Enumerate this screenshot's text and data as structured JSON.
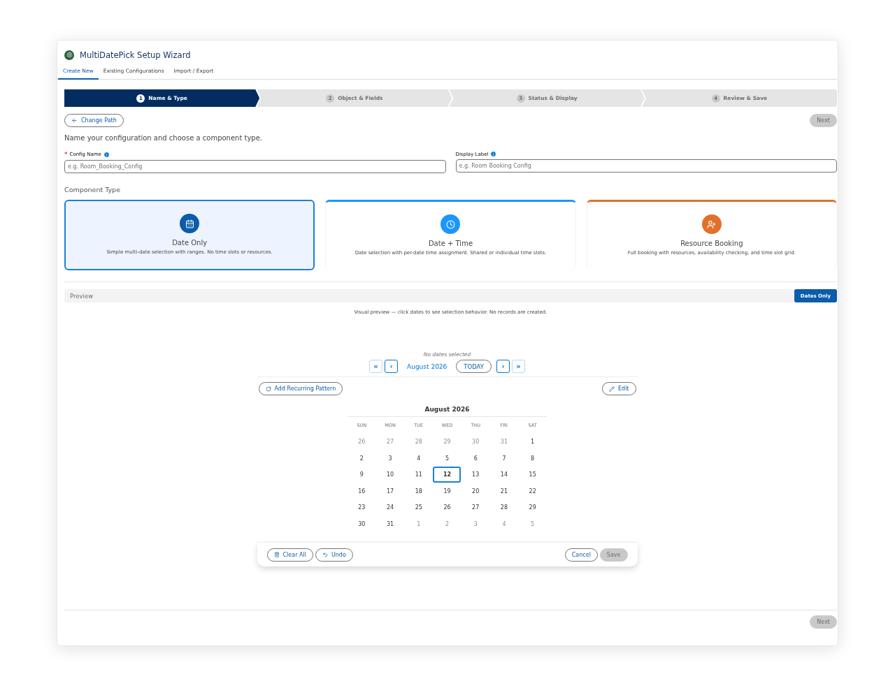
{
  "window": {
    "title": "MultiDatePick Setup Wizard"
  },
  "tabs": [
    {
      "label": "Create New",
      "selected": true
    },
    {
      "label": "Existing Configurations",
      "selected": false
    },
    {
      "label": "Import / Export",
      "selected": false
    }
  ],
  "steps": [
    {
      "number": "1",
      "label": "Name & Type",
      "selected": true
    },
    {
      "number": "2",
      "label": "Object & Fields",
      "selected": false
    },
    {
      "number": "3",
      "label": "Status & Display",
      "selected": false
    },
    {
      "number": "4",
      "label": "Review & Save",
      "selected": false
    }
  ],
  "change_path_button": "Change Path",
  "next_button_top": {
    "label": "Next",
    "disabled": true
  },
  "description": "Name your configuration and choose a component type.",
  "fields": [
    {
      "required_mark": "*",
      "label": "Config Name",
      "placeholder": "e.g. Room_Booking_Config"
    },
    {
      "label": "Display Label",
      "placeholder": "e.g. Room Booking Config"
    }
  ],
  "component_type_label": "Component Type",
  "component_types": [
    {
      "kind": "calendar",
      "title": "Date Only",
      "description": "Simple multi-date selection with ranges. No time slots or resources.",
      "color": "#0b5cab",
      "selected": true
    },
    {
      "kind": "clock",
      "title": "Date + Time",
      "description": "Date selection with per-date time assignment. Shared or individual time slots.",
      "color": "#1b96ff",
      "selected": false
    },
    {
      "kind": "people",
      "title": "Resource Booking",
      "description": "Full booking with resources, availability checking, and time slot grid.",
      "color": "#e3702a",
      "selected": false
    }
  ],
  "preview": {
    "label": "Preview",
    "mode_badge": "Dates Only",
    "hint": "Visual preview — click dates to see selection behavior. No records are created."
  },
  "calendar": {
    "status": "No dates selected",
    "nav": {
      "first": "«",
      "prev": "‹",
      "month": "August 2026",
      "today": "TODAY",
      "next": "›",
      "last": "»"
    },
    "add_recurring_button": "Add Recurring Pattern",
    "edit_button": "Edit",
    "month_title": "August 2026",
    "weekdays": [
      "SUN",
      "MON",
      "TUE",
      "WED",
      "THU",
      "FRI",
      "SAT"
    ],
    "weeks": [
      [
        {
          "day": "26",
          "outside": true,
          "today": false
        },
        {
          "day": "27",
          "outside": true,
          "today": false
        },
        {
          "day": "28",
          "outside": true,
          "today": false
        },
        {
          "day": "29",
          "outside": true,
          "today": false
        },
        {
          "day": "30",
          "outside": true,
          "today": false
        },
        {
          "day": "31",
          "outside": true,
          "today": false
        },
        {
          "day": "1",
          "outside": false,
          "today": false
        }
      ],
      [
        {
          "day": "2",
          "outside": false,
          "today": false
        },
        {
          "day": "3",
          "outside": false,
          "today": false
        },
        {
          "day": "4",
          "outside": false,
          "today": false
        },
        {
          "day": "5",
          "outside": false,
          "today": false
        },
        {
          "day": "6",
          "outside": false,
          "today": false
        },
        {
          "day": "7",
          "outside": false,
          "today": false
        },
        {
          "day": "8",
          "outside": false,
          "today": false
        }
      ],
      [
        {
          "day": "9",
          "outside": false,
          "today": false
        },
        {
          "day": "10",
          "outside": false,
          "today": false
        },
        {
          "day": "11",
          "outside": false,
          "today": false
        },
        {
          "day": "12",
          "outside": false,
          "today": true
        },
        {
          "day": "13",
          "outside": false,
          "today": false
        },
        {
          "day": "14",
          "outside": false,
          "today": false
        },
        {
          "day": "15",
          "outside": false,
          "today": false
        }
      ],
      [
        {
          "day": "16",
          "outside": false,
          "today": false
        },
        {
          "day": "17",
          "outside": false,
          "today": false
        },
        {
          "day": "18",
          "outside": false,
          "today": false
        },
        {
          "day": "19",
          "outside": false,
          "today": false
        },
        {
          "day": "20",
          "outside": false,
          "today": false
        },
        {
          "day": "21",
          "outside": false,
          "today": false
        },
        {
          "day": "22",
          "outside": false,
          "today": false
        }
      ],
      [
        {
          "day": "23",
          "outside": false,
          "today": false
        },
        {
          "day": "24",
          "outside": false,
          "today": false
        },
        {
          "day": "25",
          "outside": false,
          "today": false
        },
        {
          "day": "26",
          "outside": false,
          "today": false
        },
        {
          "day": "27",
          "outside": false,
          "today": false
        },
        {
          "day": "28",
          "outside": false,
          "today": false
        },
        {
          "day": "29",
          "outside": false,
          "today": false
        }
      ],
      [
        {
          "day": "30",
          "outside": false,
          "today": false
        },
        {
          "day": "31",
          "outside": false,
          "today": false
        },
        {
          "day": "1",
          "outside": true,
          "today": false
        },
        {
          "day": "2",
          "outside": true,
          "today": false
        },
        {
          "day": "3",
          "outside": true,
          "today": false
        },
        {
          "day": "4",
          "outside": true,
          "today": false
        },
        {
          "day": "5",
          "outside": true,
          "today": false
        }
      ]
    ],
    "clear_all_button": "Clear All",
    "undo_button": "Undo",
    "cancel_button": "Cancel",
    "save_button": {
      "label": "Save",
      "disabled": true
    }
  },
  "next_button_bottom": {
    "label": "Next",
    "disabled": true
  }
}
